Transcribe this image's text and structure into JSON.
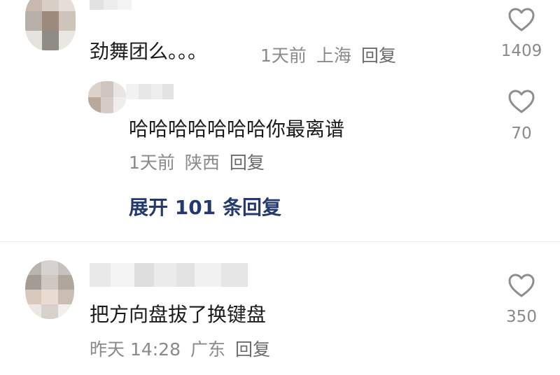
{
  "comments": [
    {
      "text": "劲舞团么。。。",
      "time": "1天前",
      "location": "上海",
      "reply_label": "回复",
      "likes": "1409"
    },
    {
      "text": "哈哈哈哈哈哈哈你最离谱",
      "time": "1天前",
      "location": "陕西",
      "reply_label": "回复",
      "likes": "70",
      "expand_label": "展开 101 条回复"
    },
    {
      "text": "把方向盘拔了换键盘",
      "time": "昨天 14:28",
      "location": "广东",
      "reply_label": "回复",
      "likes": "350"
    }
  ],
  "icons": {
    "like": "heart-outline-icon"
  },
  "colors": {
    "text": "#1b1b1b",
    "meta": "#8a8a8a",
    "link": "#243a6e",
    "icon": "#8e8e8e"
  }
}
